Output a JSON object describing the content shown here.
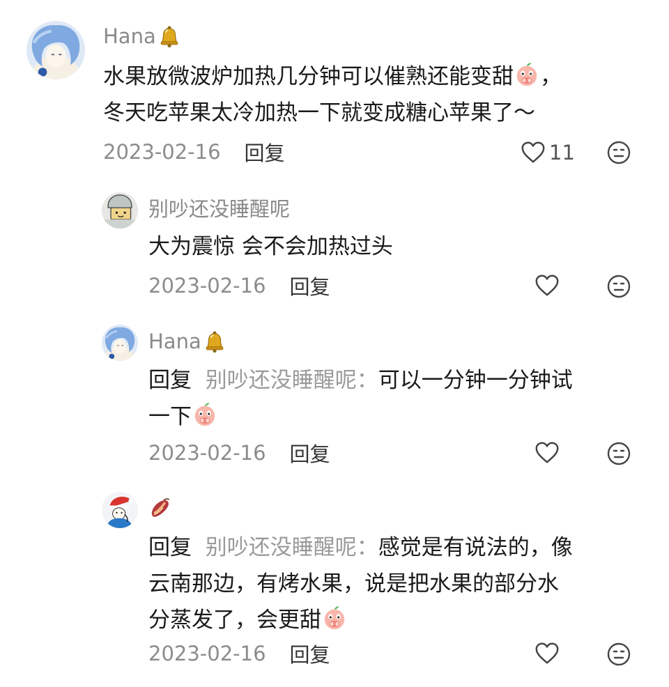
{
  "comments": [
    {
      "username": "Hana",
      "username_badge": "bell-emoji",
      "lines": [
        "水果放微波炉加热几分钟可以催熟还能变甜",
        "，",
        "冬天吃苹果太冷加热一下就变成糖心苹果了～"
      ],
      "date": "2023-02-16",
      "reply_label": "回复",
      "like_count": "11"
    },
    {
      "username": "别吵还没睡醒呢",
      "text": "大为震惊 会不会加热过头",
      "date": "2023-02-16",
      "reply_label": "回复"
    },
    {
      "username": "Hana",
      "username_badge": "bell-emoji",
      "reply_prefix": "回复",
      "reply_target": "别吵还没睡醒呢：",
      "line1": "可以一分钟一分钟试",
      "line2": "一下",
      "date": "2023-02-16",
      "reply_label": "回复"
    },
    {
      "username_emoji": "sweet-potato-emoji",
      "reply_prefix": "回复",
      "reply_target": "别吵还没睡醒呢：",
      "line1": "感觉是有说法的，像",
      "line2": "云南那边，有烤水果，说是把水果的部分水",
      "line3": "分蒸发了，会更甜",
      "date": "2023-02-16",
      "reply_label": "回复"
    }
  ],
  "colors": {
    "username": "#8a8a8a",
    "text": "#1a1a1a",
    "meta": "#8c8c8c",
    "reply_target": "#9a9a9a"
  },
  "icons": [
    "heart-outline-icon",
    "emoji-face-icon",
    "peach-emoji",
    "bell-emoji",
    "sweet-potato-emoji"
  ]
}
